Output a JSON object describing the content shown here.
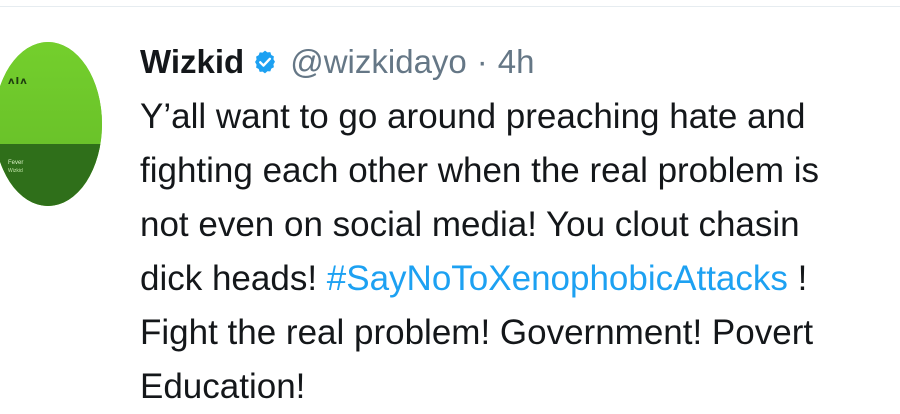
{
  "tweet": {
    "author_name": "Wizkid",
    "handle": "@wizkidayo",
    "separator": "·",
    "time": "4h",
    "lines": [
      "Y’all want to go around preaching hate and",
      "fighting each other when the real problem is",
      "not even on social media! You clout chasin",
      "Fight the real problem! Government! Povert",
      "Education!"
    ],
    "line4_before": "dick heads! ",
    "hashtag": "#SayNoToXenophobicAttacks",
    "line4_after": " !"
  },
  "avatar": {
    "logo_text": "ᴧIᴧ",
    "album_title": "Fever",
    "album_sub": "Wizkid"
  },
  "colors": {
    "hashtag": "#1da1f2",
    "handle": "#657786",
    "verified": "#1da1f2",
    "avatar_green": "#6cc32a"
  },
  "icons": {
    "verified": "verified-badge-icon"
  }
}
